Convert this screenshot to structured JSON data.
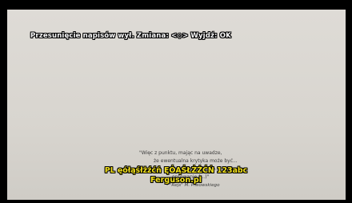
{
  "osd": {
    "message": "Przesunięcie napisów wył. Zmiana: <◇> Wyjdź: OK"
  },
  "quote": {
    "line1": "\"Więc z punktu, mając na uwadze,",
    "line2": "że ewentualna krytyka może być...",
    "line3": "... ... ... ... ... ... ... ... ... ... ... ...ryło...",
    "line4": "... ... ...optowanie (...)\"",
    "line5": "- \"Rejs\" M. Piwowskiego"
  },
  "subtitles": {
    "line1": "PL ęółąśłżźćń ĘÓĄŚŁŻŹĆŃ 123abc",
    "line2": "Ferguson.pl"
  }
}
